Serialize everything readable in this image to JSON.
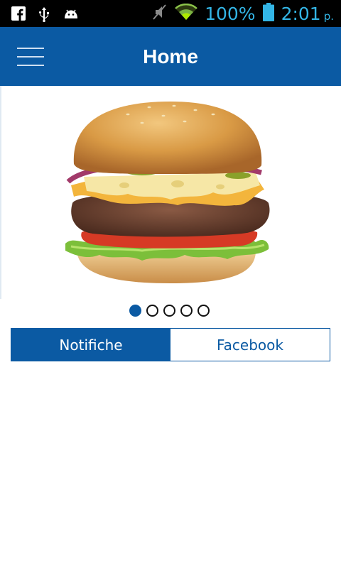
{
  "status_bar": {
    "battery_percent": "100%",
    "time": "2:01",
    "ampm": "p.",
    "icons": [
      "facebook-icon",
      "usb-icon",
      "android-icon",
      "mute-icon",
      "wifi-icon",
      "battery-icon"
    ],
    "accent_color": "#33b5e5"
  },
  "app_bar": {
    "title": "Home",
    "menu_icon": "hamburger-icon",
    "color": "#0b5aa3"
  },
  "carousel": {
    "image": "burger-photo",
    "pages": 5,
    "active_page": 1
  },
  "tabs": [
    {
      "label": "Notifiche",
      "active": true
    },
    {
      "label": "Facebook",
      "active": false
    }
  ]
}
